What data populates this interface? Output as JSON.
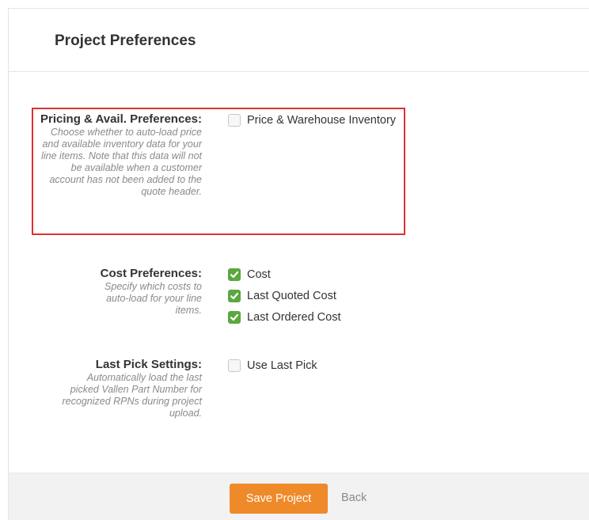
{
  "panel": {
    "title": "Project Preferences"
  },
  "preferences": [
    {
      "title": "Pricing & Avail. Preferences:",
      "description": "Choose whether to auto-load price and available inventory data for your line items. Note that this data will not be available when a customer account has not been added to the quote header.",
      "options": [
        {
          "label": "Price & Warehouse Inventory",
          "checked": false
        }
      ]
    },
    {
      "title": "Cost Preferences:",
      "description": "Specify which costs to auto-load for your line items.",
      "options": [
        {
          "label": "Cost",
          "checked": true
        },
        {
          "label": "Last Quoted Cost",
          "checked": true
        },
        {
          "label": "Last Ordered Cost",
          "checked": true
        }
      ]
    },
    {
      "title": "Last Pick Settings:",
      "description": "Automatically load the last picked Vallen Part Number for recognized RPNs during project upload.",
      "options": [
        {
          "label": "Use Last Pick",
          "checked": false
        }
      ]
    }
  ],
  "footer": {
    "save_label": "Save Project",
    "back_label": "Back"
  },
  "colors": {
    "accent": "#ef8a2a",
    "check": "#5aa83e",
    "highlight": "#e0302f"
  }
}
